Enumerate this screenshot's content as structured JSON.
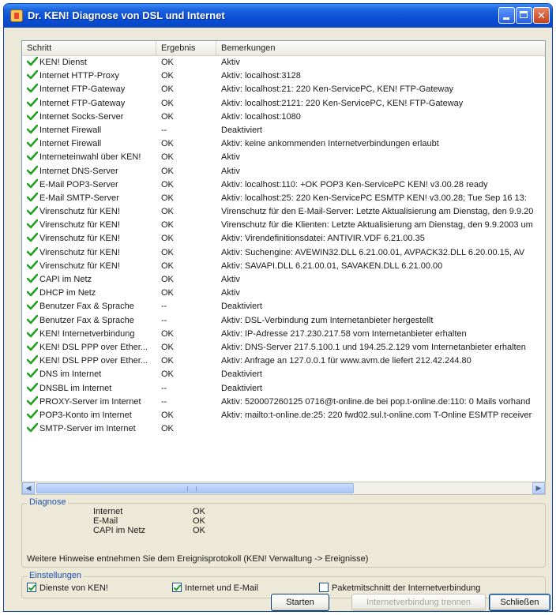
{
  "window": {
    "title": "Dr. KEN! Diagnose von DSL und Internet"
  },
  "list": {
    "columns": [
      "Schritt",
      "Ergebnis",
      "Bemerkungen"
    ],
    "rows": [
      {
        "step": "KEN! Dienst",
        "result": "OK",
        "remark": "Aktiv"
      },
      {
        "step": "Internet HTTP-Proxy",
        "result": "OK",
        "remark": "Aktiv: localhost:3128"
      },
      {
        "step": "Internet FTP-Gateway",
        "result": "OK",
        "remark": "Aktiv: localhost:21: 220 Ken-ServicePC, KEN! FTP-Gateway"
      },
      {
        "step": "Internet FTP-Gateway",
        "result": "OK",
        "remark": "Aktiv: localhost:2121: 220 Ken-ServicePC, KEN! FTP-Gateway"
      },
      {
        "step": "Internet Socks-Server",
        "result": "OK",
        "remark": "Aktiv: localhost:1080"
      },
      {
        "step": "Internet Firewall",
        "result": "--",
        "remark": "Deaktiviert"
      },
      {
        "step": "Internet Firewall",
        "result": "OK",
        "remark": "Aktiv: keine ankommenden Internetverbindungen erlaubt"
      },
      {
        "step": "Interneteinwahl über KEN!",
        "result": "OK",
        "remark": "Aktiv"
      },
      {
        "step": "Internet DNS-Server",
        "result": "OK",
        "remark": "Aktiv"
      },
      {
        "step": "E-Mail POP3-Server",
        "result": "OK",
        "remark": "Aktiv: localhost:110: +OK POP3 Ken-ServicePC KEN! v3.00.28 ready"
      },
      {
        "step": "E-Mail SMTP-Server",
        "result": "OK",
        "remark": "Aktiv: localhost:25: 220 Ken-ServicePC ESMTP KEN! v3.00.28; Tue Sep 16 13:"
      },
      {
        "step": "Virenschutz für KEN!",
        "result": "OK",
        "remark": "Virenschutz für den E-Mail-Server: Letzte Aktualisierung am Dienstag, den 9.9.20"
      },
      {
        "step": "Virenschutz für KEN!",
        "result": "OK",
        "remark": "Virenschutz für die Klienten: Letzte Aktualisierung am Dienstag, den 9.9.2003 um"
      },
      {
        "step": "Virenschutz für KEN!",
        "result": "OK",
        "remark": "Aktiv: Virendefinitionsdatei: ANTIVIR.VDF 6.21.00.35"
      },
      {
        "step": "Virenschutz für KEN!",
        "result": "OK",
        "remark": "Aktiv: Suchengine: AVEWIN32.DLL 6.21.00.01, AVPACK32.DLL 6.20.00.15, AV"
      },
      {
        "step": "Virenschutz für KEN!",
        "result": "OK",
        "remark": "Aktiv: SAVAPI.DLL 6.21.00.01, SAVAKEN.DLL 6.21.00.00"
      },
      {
        "step": "CAPI im Netz",
        "result": "OK",
        "remark": "Aktiv"
      },
      {
        "step": "DHCP im Netz",
        "result": "OK",
        "remark": "Aktiv"
      },
      {
        "step": "Benutzer Fax & Sprache",
        "result": "--",
        "remark": "Deaktiviert"
      },
      {
        "step": "Benutzer Fax & Sprache",
        "result": "--",
        "remark": "Aktiv: DSL-Verbindung zum Internetanbieter hergestellt"
      },
      {
        "step": "KEN! Internetverbindung",
        "result": "OK",
        "remark": "Aktiv: IP-Adresse 217.230.217.58 vom Internetanbieter erhalten"
      },
      {
        "step": "KEN! DSL PPP over Ether...",
        "result": "OK",
        "remark": "Aktiv: DNS-Server 217.5.100.1 und 194.25.2.129 vom Internetanbieter erhalten"
      },
      {
        "step": "KEN! DSL PPP over Ether...",
        "result": "OK",
        "remark": "Aktiv: Anfrage an 127.0.0.1 für www.avm.de liefert 212.42.244.80"
      },
      {
        "step": "DNS im Internet",
        "result": "OK",
        "remark": "Deaktiviert"
      },
      {
        "step": "DNSBL im Internet",
        "result": "--",
        "remark": "Deaktiviert"
      },
      {
        "step": "PROXY-Server im Internet",
        "result": "--",
        "remark": "Aktiv: 520007260125 0716@t-online.de bei pop.t-online.de:110: 0 Mails vorhand"
      },
      {
        "step": "POP3-Konto im Internet",
        "result": "OK",
        "remark": "Aktiv: mailto:t-online.de:25: 220 fwd02.sul.t-online.com T-Online ESMTP receiver"
      },
      {
        "step": "SMTP-Server im Internet",
        "result": "OK",
        "remark": ""
      }
    ]
  },
  "diagnose": {
    "label": "Diagnose",
    "items": [
      {
        "label": "Internet",
        "value": "OK"
      },
      {
        "label": "E-Mail",
        "value": "OK"
      },
      {
        "label": "CAPI im Netz",
        "value": "OK"
      }
    ],
    "note": "Weitere Hinweise entnehmen Sie dem Ereignisprotokoll (KEN! Verwaltung -> Ereignisse)"
  },
  "settings": {
    "label": "Einstellungen",
    "options": [
      {
        "label": "Dienste von KEN!",
        "checked": true
      },
      {
        "label": "Internet und E-Mail",
        "checked": true
      },
      {
        "label": "Paketmitschnitt der Internetverbindung",
        "checked": false
      }
    ]
  },
  "buttons": {
    "start": "Starten",
    "disconnect": "Internetverbindung trennen",
    "close": "Schließen"
  },
  "colors": {
    "titlebar": "#0b4fd6",
    "check": "#21a121",
    "group_label": "#1d4fae"
  }
}
